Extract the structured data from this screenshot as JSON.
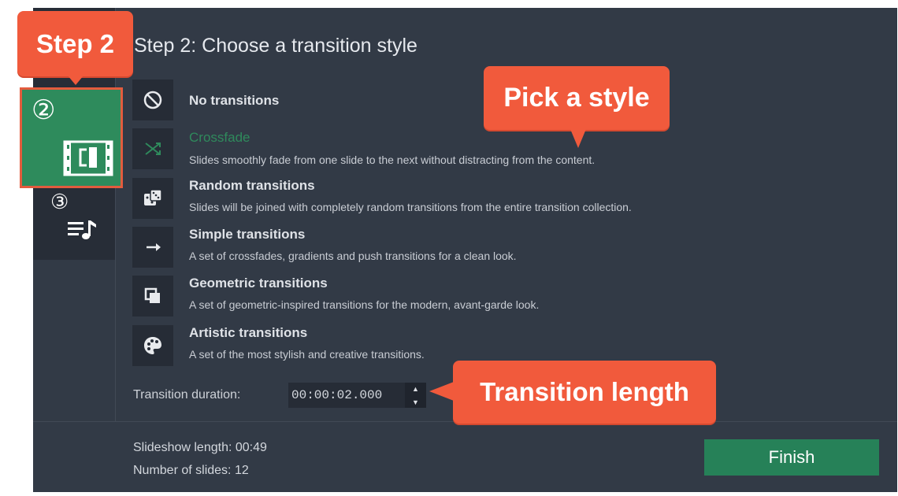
{
  "step_title": "Step 2: Choose a transition style",
  "options": [
    {
      "icon": "no-transitions-icon",
      "name": "No transitions",
      "description": ""
    },
    {
      "icon": "crossfade-icon",
      "name": "Crossfade",
      "description": "Slides smoothly fade from one slide to the next without distracting from the content.",
      "selected": true
    },
    {
      "icon": "dice-icon",
      "name": "Random transitions",
      "description": "Slides will be joined with completely random transitions from the entire transition collection."
    },
    {
      "icon": "arrow-right-icon",
      "name": "Simple transitions",
      "description": "A set of crossfades, gradients and push transitions for a clean look."
    },
    {
      "icon": "squares-icon",
      "name": "Geometric transitions",
      "description": "A set of geometric-inspired transitions for the modern, avant-garde look."
    },
    {
      "icon": "palette-icon",
      "name": "Artistic transitions",
      "description": "A set of the most stylish and creative transitions."
    }
  ],
  "duration": {
    "label": "Transition duration:",
    "value": "00:00:02.000"
  },
  "summary": {
    "length": "Slideshow length: 00:49",
    "slides": "Number of slides: 12"
  },
  "finish_label": "Finish",
  "steps": {
    "step2_number": "②",
    "step3_number": "③"
  },
  "callouts": {
    "step": "Step 2",
    "style": "Pick a style",
    "length": "Transition length"
  },
  "colors": {
    "accent_green": "#2e8b5c",
    "callout": "#f15a3c",
    "panel": "#323a46"
  }
}
